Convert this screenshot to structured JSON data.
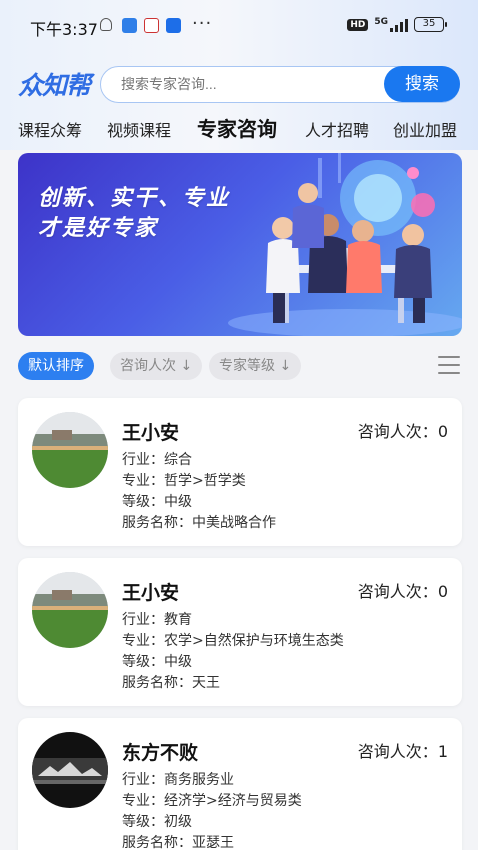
{
  "status_bar": {
    "time": "下午3:37",
    "more": "···",
    "hd": "HD",
    "network": "5G",
    "battery": "35"
  },
  "header": {
    "logo": "众知帮",
    "search_placeholder": "搜索专家咨询...",
    "search_button": "搜索"
  },
  "nav": {
    "tabs": [
      "课程众筹",
      "视频课程",
      "专家咨询",
      "人才招聘",
      "创业加盟"
    ],
    "active_index": 2
  },
  "banner": {
    "line1": "创新、实干、专业",
    "line2": "才是好专家"
  },
  "sort": {
    "default": "默认排序",
    "by_consults": "咨询人次 ↓",
    "by_level": "专家等级 ↓"
  },
  "experts": [
    {
      "name": "王小安",
      "count_label": "咨询人次：",
      "count": "0",
      "industry": "行业：综合",
      "major": "专业：哲学>哲学类",
      "level": "等级：中级",
      "service": "服务名称：中美战略合作",
      "avatar": "field-photo"
    },
    {
      "name": "王小安",
      "count_label": "咨询人次：",
      "count": "0",
      "industry": "行业：教育",
      "major": "专业：农学>自然保护与环境生态类",
      "level": "等级：中级",
      "service": "服务名称：天王",
      "avatar": "field-photo"
    },
    {
      "name": "东方不败",
      "count_label": "咨询人次：",
      "count": "1",
      "industry": "行业：商务服务业",
      "major": "专业：经济学>经济与贸易类",
      "level": "等级：初级",
      "service": "服务名称：亚瑟王",
      "avatar": "dark-photo"
    }
  ],
  "colors": {
    "accent": "#1a78f0",
    "logo": "#2f6de3",
    "chip_active": "#2d7ff0",
    "page_bg": "#f3f4f7"
  }
}
